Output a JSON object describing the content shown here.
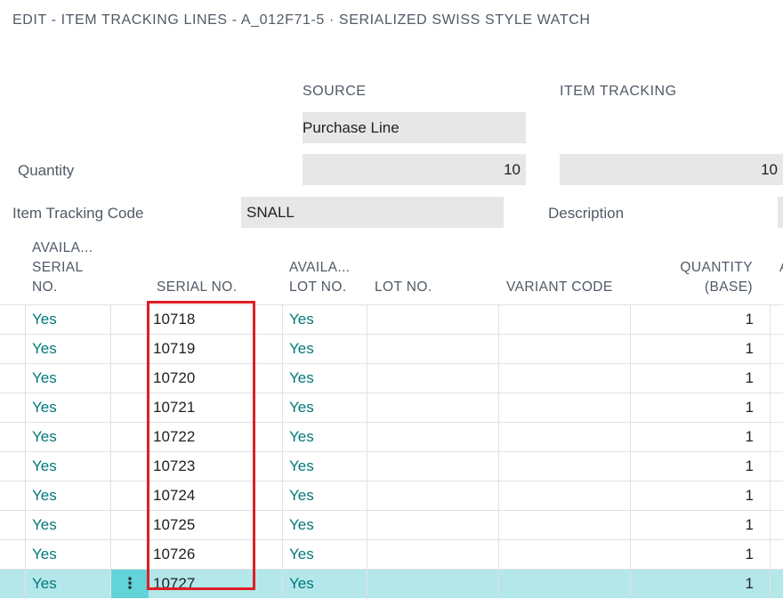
{
  "window": {
    "title": "EDIT - ITEM TRACKING LINES - A_012F71-5 · SERIALIZED SWISS STYLE WATCH"
  },
  "summary": {
    "source_header": "SOURCE",
    "item_tracking_header": "ITEM TRACKING",
    "source_type_value": "Purchase Line",
    "quantity_label": "Quantity",
    "quantity_source_value": "10",
    "quantity_item_tracking_value": "10",
    "item_tracking_code_label": "Item Tracking Code",
    "item_tracking_code_value": "SNALL",
    "description_label": "Description"
  },
  "grid": {
    "columns": {
      "avail_serial": [
        "AVAILA...",
        "SERIAL",
        "NO."
      ],
      "serial_no": "SERIAL NO.",
      "avail_lot": [
        "AVAILA...",
        "LOT NO."
      ],
      "lot_no": "LOT NO.",
      "variant_code": "VARIANT CODE",
      "quantity_base": [
        "QUANTITY",
        "(BASE)"
      ],
      "partial": "A"
    },
    "rows": [
      {
        "avail_serial": "Yes",
        "serial_no": "10718",
        "avail_lot": "Yes",
        "lot_no": "",
        "variant_code": "",
        "quantity_base": "1"
      },
      {
        "avail_serial": "Yes",
        "serial_no": "10719",
        "avail_lot": "Yes",
        "lot_no": "",
        "variant_code": "",
        "quantity_base": "1"
      },
      {
        "avail_serial": "Yes",
        "serial_no": "10720",
        "avail_lot": "Yes",
        "lot_no": "",
        "variant_code": "",
        "quantity_base": "1"
      },
      {
        "avail_serial": "Yes",
        "serial_no": "10721",
        "avail_lot": "Yes",
        "lot_no": "",
        "variant_code": "",
        "quantity_base": "1"
      },
      {
        "avail_serial": "Yes",
        "serial_no": "10722",
        "avail_lot": "Yes",
        "lot_no": "",
        "variant_code": "",
        "quantity_base": "1"
      },
      {
        "avail_serial": "Yes",
        "serial_no": "10723",
        "avail_lot": "Yes",
        "lot_no": "",
        "variant_code": "",
        "quantity_base": "1"
      },
      {
        "avail_serial": "Yes",
        "serial_no": "10724",
        "avail_lot": "Yes",
        "lot_no": "",
        "variant_code": "",
        "quantity_base": "1"
      },
      {
        "avail_serial": "Yes",
        "serial_no": "10725",
        "avail_lot": "Yes",
        "lot_no": "",
        "variant_code": "",
        "quantity_base": "1"
      },
      {
        "avail_serial": "Yes",
        "serial_no": "10726",
        "avail_lot": "Yes",
        "lot_no": "",
        "variant_code": "",
        "quantity_base": "1"
      },
      {
        "avail_serial": "Yes",
        "serial_no": "10727",
        "avail_lot": "Yes",
        "lot_no": "",
        "variant_code": "",
        "quantity_base": "1",
        "selected": true,
        "row_menu": "⋮"
      }
    ]
  },
  "colors": {
    "accent_teal": "#00787a",
    "selected_row": "#b3e7ea",
    "highlight_box": "#e01e26"
  }
}
